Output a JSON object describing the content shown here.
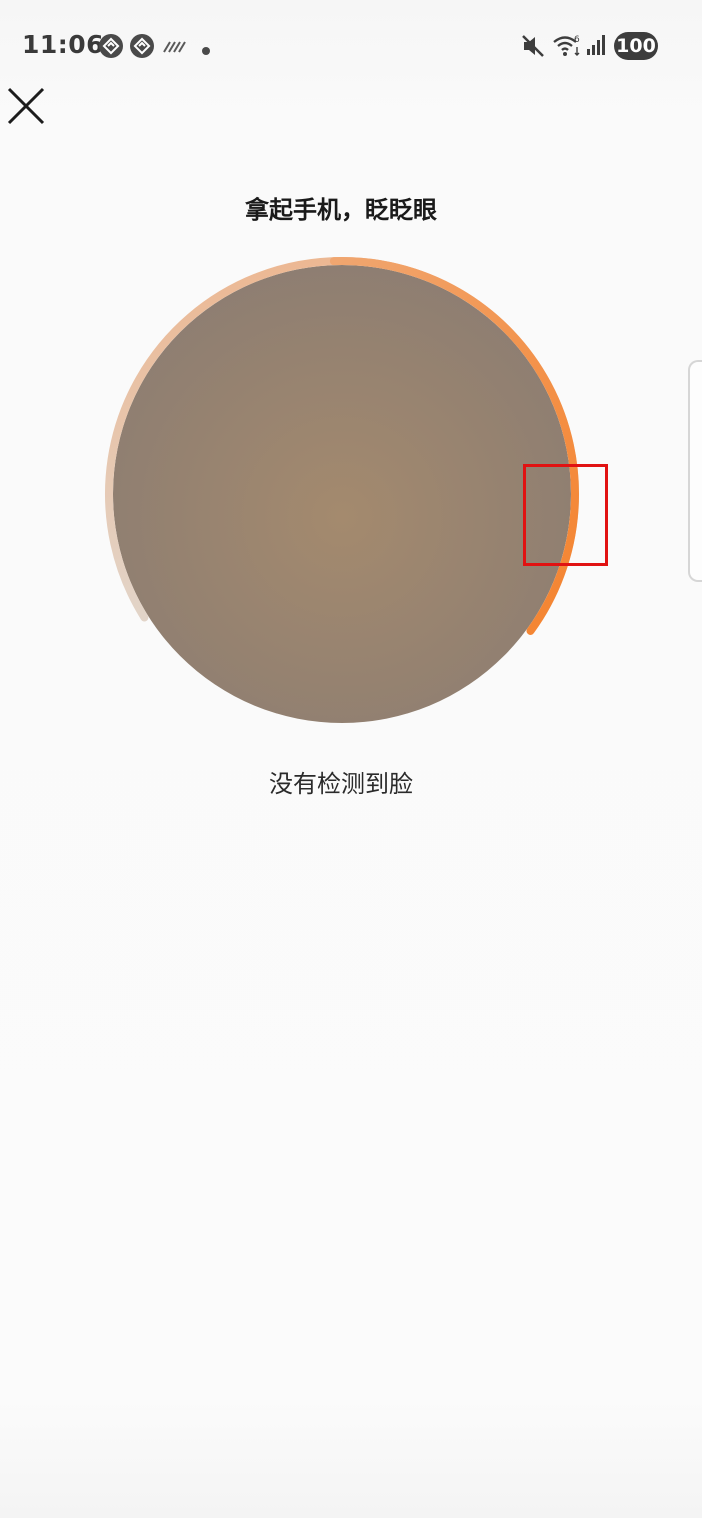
{
  "status_bar": {
    "time": "11:06",
    "battery": "100",
    "icons": [
      "app-notification-icon",
      "app-notification-icon",
      "data-activity-icon",
      "notification-dot-icon",
      "mute-icon",
      "wifi-icon",
      "signal-icon",
      "battery-icon"
    ]
  },
  "header": {
    "close_icon": "close-icon"
  },
  "liveness": {
    "title": "拿起手机，眨眨眼",
    "status_message": "没有检测到脸",
    "progress_fraction": 0.35,
    "progress_color": "#f58a3c",
    "track_color": "#d9cbbf"
  },
  "overlay": {
    "highlight_color": "#e11212"
  }
}
